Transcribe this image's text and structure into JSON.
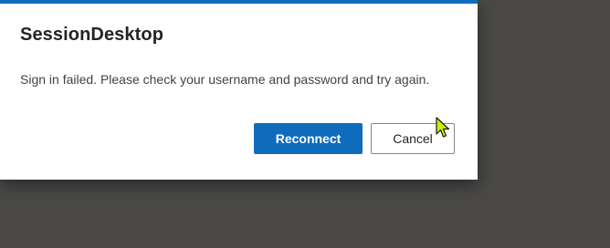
{
  "dialog": {
    "title": "SessionDesktop",
    "message": "Sign in failed. Please check your username and password and try again.",
    "accent_color": "#0f6cbd",
    "buttons": {
      "reconnect_label": "Reconnect",
      "cancel_label": "Cancel"
    }
  },
  "cursor": {
    "icon": "mouse-pointer-icon",
    "color": "#c8f000"
  }
}
